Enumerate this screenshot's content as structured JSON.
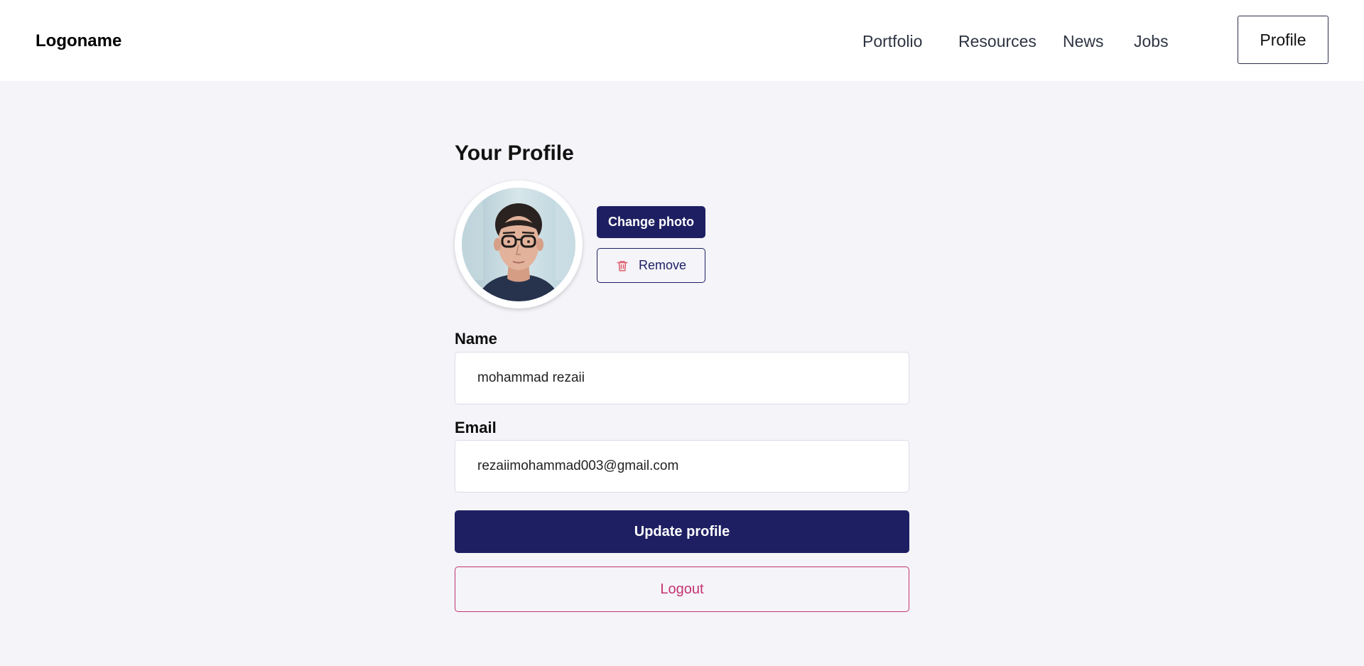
{
  "header": {
    "logo": "Logoname",
    "nav": [
      {
        "label": "Portfolio"
      },
      {
        "label": "Resources"
      },
      {
        "label": "News"
      },
      {
        "label": "Jobs"
      }
    ],
    "profile_label": "Profile"
  },
  "main": {
    "title": "Your Profile",
    "avatar_icon": "avatar-photo",
    "change_photo_label": "Change photo",
    "remove_label": "Remove",
    "remove_icon": "trash-icon",
    "name_label": "Name",
    "name_value": "mohammad rezaii",
    "email_label": "Email",
    "email_value": "rezaiimohammad003@gmail.com",
    "update_label": "Update profile",
    "logout_label": "Logout"
  },
  "colors": {
    "primary": "#1e1f62",
    "logout": "#c4336f",
    "background": "#f4f4f9",
    "remove_icon": "#e05a6a"
  }
}
